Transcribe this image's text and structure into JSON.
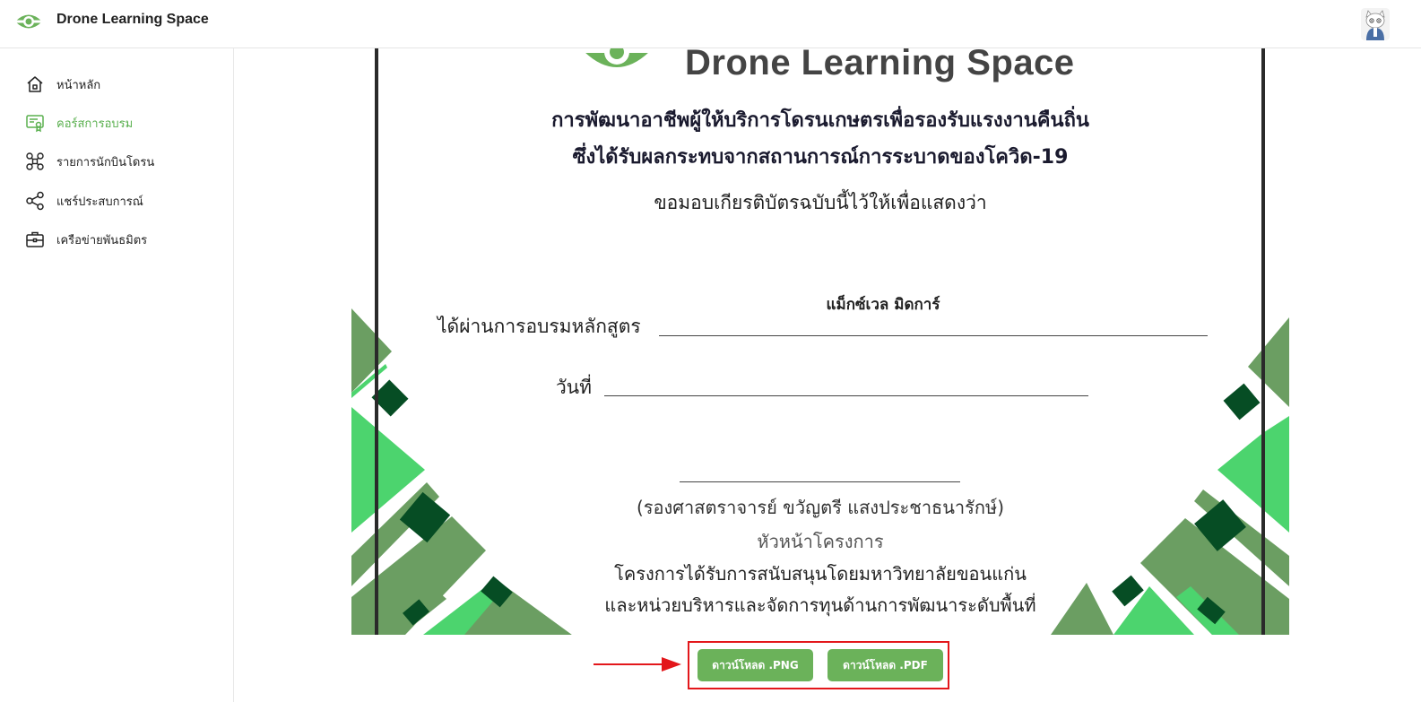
{
  "header": {
    "brand": "Drone Learning Space",
    "logo_icon": "drone-eye-logo-icon",
    "avatar_icon": "cat-avatar-icon"
  },
  "sidebar": {
    "items": [
      {
        "label": "หน้าหลัก",
        "icon": "home-icon",
        "active": false
      },
      {
        "label": "คอร์สการอบรม",
        "icon": "certificate-icon",
        "active": true
      },
      {
        "label": "รายการนักบินโดรน",
        "icon": "drone-icon",
        "active": false
      },
      {
        "label": "แชร์ประสบการณ์",
        "icon": "share-icon",
        "active": false
      },
      {
        "label": "เครือข่ายพันธมิตร",
        "icon": "briefcase-icon",
        "active": false
      }
    ]
  },
  "certificate": {
    "logo_text": "Drone Learning Space",
    "title_line1": "การพัฒนาอาชีพผู้ให้บริการโดรนเกษตรเพื่อรองรับแรงงานคืนถิ่น",
    "title_line2": "ซึ่งได้รับผลกระทบจากสถานการณ์การระบาดของโควิด-19",
    "subtitle": "ขอมอบเกียรติบัตรฉบับนี้ไว้ให้เพื่อแสดงว่า",
    "recipient_name": "แม็กซ์เวล มิดการ์",
    "passed_label": "ได้ผ่านการอบรมหลักสูตร",
    "date_label": "วันที่",
    "signer": "(รองศาสตราจารย์ ขวัญตรี แสงประชาธนารักษ์)",
    "signer_role": "หัวหน้าโครงการ",
    "support_line1": "โครงการได้รับการสนับสนุนโดยมหาวิทยาลัยขอนแก่น",
    "support_line2": "และหน่วยบริหารและจัดการทุนด้านการพัฒนาระดับพื้นที่"
  },
  "downloads": {
    "png_label": "ดาวน์โหลด .PNG",
    "pdf_label": "ดาวน์โหลด .PDF"
  },
  "colors": {
    "accent": "#6bb25a",
    "active_text": "#5ab04f",
    "highlight_box": "#e3171b",
    "decor_light": "#4cd46e",
    "decor_mid": "#6b9e62",
    "decor_dark": "#064d24"
  }
}
